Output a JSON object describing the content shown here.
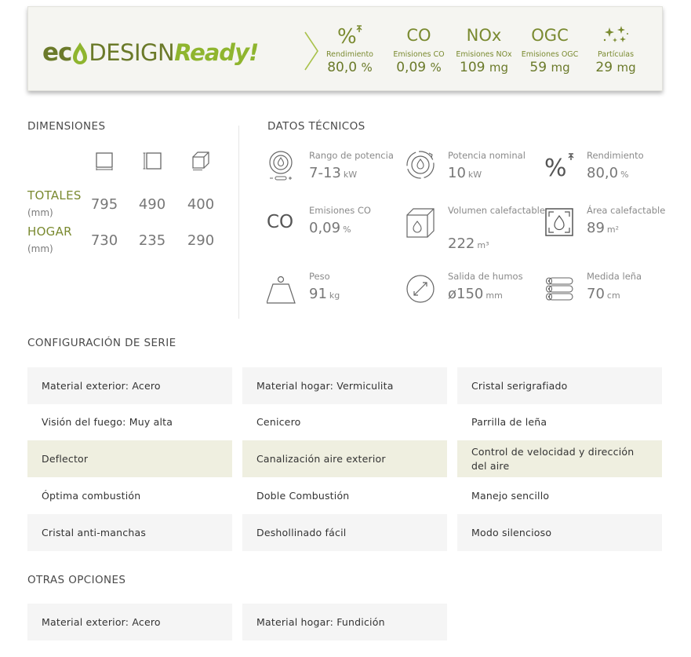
{
  "eco": {
    "logo_eco": "ec",
    "logo_design": "DESIGN",
    "logo_ready": "Ready!",
    "colors": {
      "dark_green": "#6b7a2a",
      "light_green": "#8fb52f"
    },
    "metrics": [
      {
        "icon": "percent-efficiency-icon",
        "label": "Rendimiento",
        "value": "80,0",
        "unit": "%"
      },
      {
        "icon_text": "CO",
        "label": "Emisiones CO",
        "value": "0,09",
        "unit": "%"
      },
      {
        "icon_text": "NOx",
        "label": "Emisiones NOx",
        "value": "109",
        "unit": "mg"
      },
      {
        "icon_text": "OGC",
        "label": "Emisiones OGC",
        "value": "59",
        "unit": "mg"
      },
      {
        "icon": "particles-icon",
        "label": "Partículas",
        "value": "29",
        "unit": "mg"
      }
    ]
  },
  "dimensions": {
    "title": "DIMENSIONES",
    "icons": [
      "width-front-icon",
      "height-side-icon",
      "depth-cube-icon"
    ],
    "rows": [
      {
        "label": "TOTALES",
        "unit": "(mm)",
        "values": [
          "795",
          "490",
          "400"
        ]
      },
      {
        "label": "HOGAR",
        "unit": "(mm)",
        "values": [
          "730",
          "235",
          "290"
        ]
      }
    ]
  },
  "tech": {
    "title": "DATOS TÉCNICOS",
    "items": [
      {
        "icon": "power-range-icon",
        "label": "Rango de potencia",
        "value": "7-13",
        "unit": "kW"
      },
      {
        "icon": "nominal-power-icon",
        "label": "Potencia nominal",
        "value": "10",
        "unit": "kW"
      },
      {
        "icon": "efficiency-icon",
        "label": "Rendimiento",
        "value": "80,0",
        "unit": "%"
      },
      {
        "icon_text": "CO",
        "label": "Emisiones CO",
        "value": "0,09",
        "unit": "%"
      },
      {
        "icon": "heated-volume-icon",
        "label": "Volumen calefactable",
        "value": "222",
        "unit": "m³"
      },
      {
        "icon": "heated-area-icon",
        "label": "Área calefactable",
        "value": "89",
        "unit": "m²"
      },
      {
        "icon": "weight-icon",
        "label": "Peso",
        "value": "91",
        "unit": "kg"
      },
      {
        "icon": "flue-outlet-icon",
        "label": "Salida de humos",
        "value": "ø150",
        "unit": "mm"
      },
      {
        "icon": "log-length-icon",
        "label": "Medida leña",
        "value": "70",
        "unit": "cm"
      }
    ]
  },
  "config": {
    "title": "CONFIGURACIÓN DE SERIE",
    "items": [
      "Material exterior: Acero",
      "Material hogar: Vermiculita",
      "Cristal serigrafiado",
      "Visión del fuego: Muy alta",
      "Cenicero",
      "Parrilla de leña",
      "Deflector",
      "Canalización aire exterior",
      "Control de velocidad y dirección del aire",
      "Óptima combustión",
      "Doble Combustión",
      "Manejo sencillo",
      "Cristal anti-manchas",
      "Deshollinado fácil",
      "Modo silencioso"
    ]
  },
  "options": {
    "title": "OTRAS OPCIONES",
    "items": [
      "Material exterior: Acero",
      "Material hogar: Fundición"
    ]
  }
}
